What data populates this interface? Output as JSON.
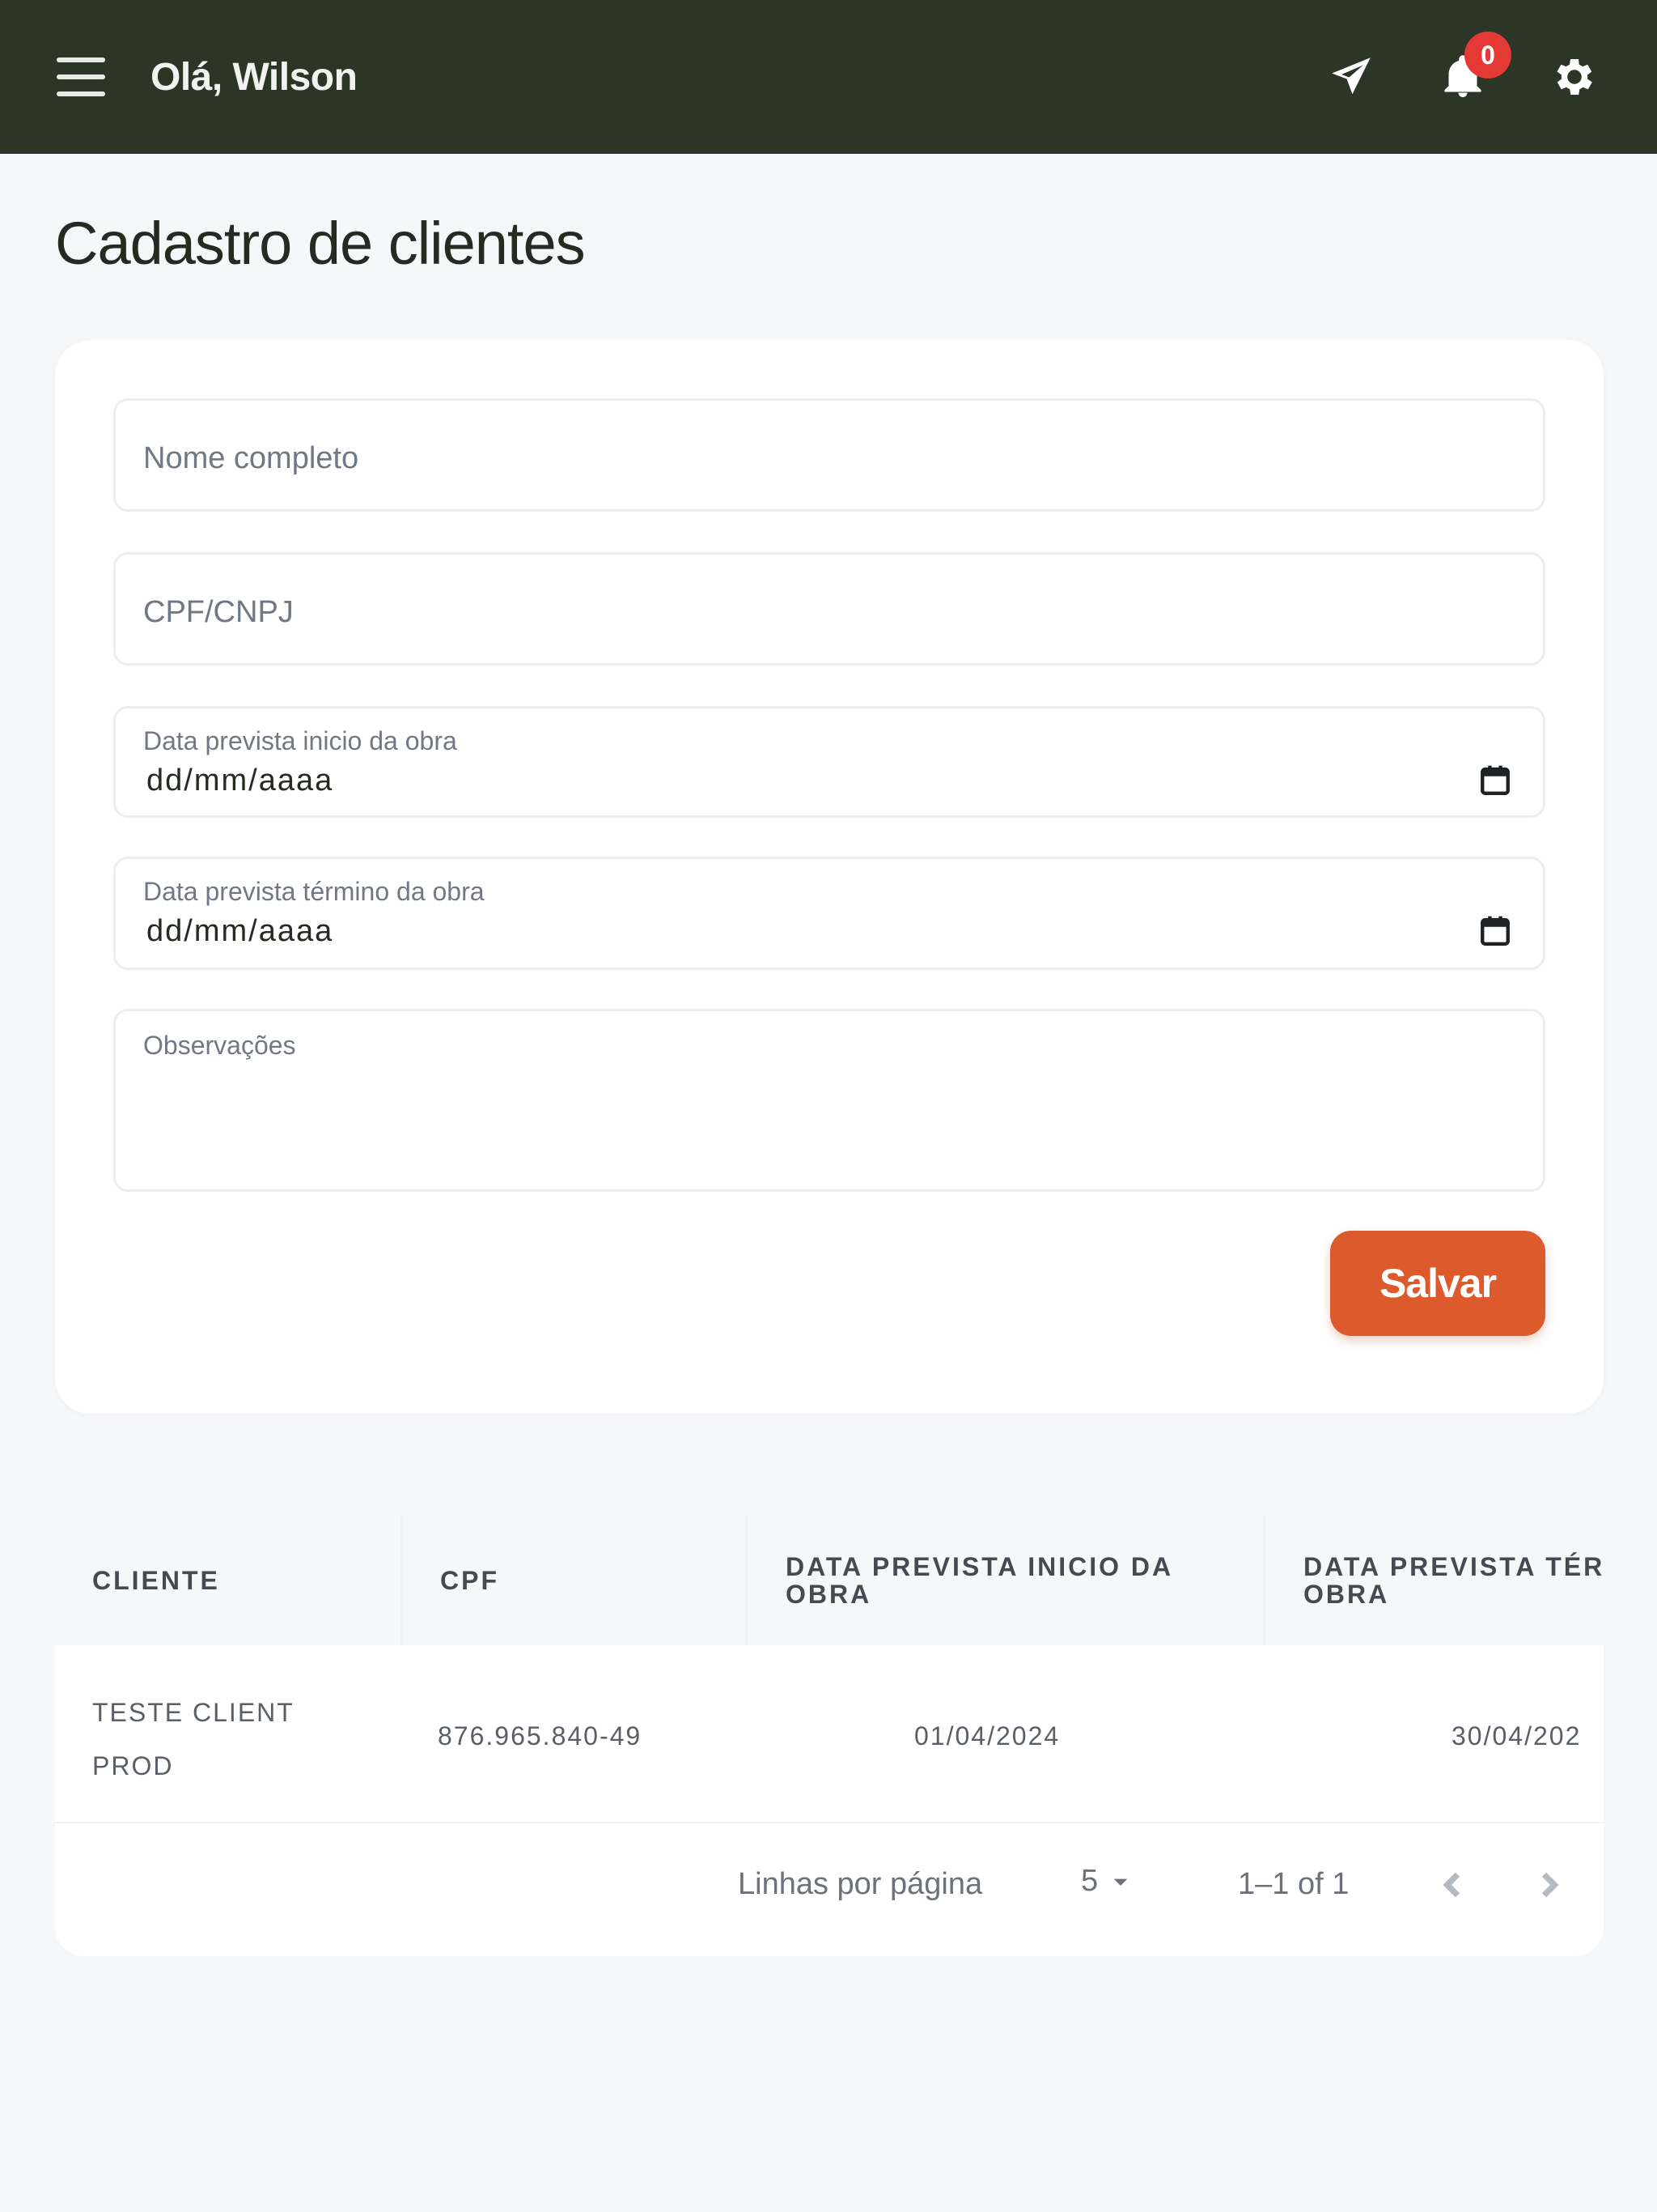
{
  "header": {
    "greeting": "Olá, Wilson",
    "notification_count": "0",
    "icons": [
      "menu-icon",
      "send-icon",
      "bell-icon",
      "gear-icon"
    ],
    "background_color": "#2b3626",
    "badge_color": "#e53935"
  },
  "page": {
    "title": "Cadastro de clientes"
  },
  "form": {
    "name_placeholder": "Nome completo",
    "name_value": "",
    "document_placeholder": "CPF/CNPJ",
    "document_value": "",
    "start_date_label": "Data prevista inicio da obra",
    "start_date_value": "dd/mm/aaaa",
    "end_date_label": "Data prevista término da obra",
    "end_date_value": "dd/mm/aaaa",
    "notes_label": "Observações",
    "notes_value": "",
    "save_label": "Salvar",
    "save_color": "#dc5a2c"
  },
  "table": {
    "columns": [
      "CLIENTE",
      "CPF",
      "DATA PREVISTA INICIO DA OBRA",
      "DATA PREVISTA TÉR OBRA"
    ],
    "rows": [
      {
        "cliente": "TESTE CLIENT PROD",
        "cpf": "876.965.840-49",
        "inicio": "01/04/2024",
        "termino": "30/04/202"
      }
    ],
    "pagination": {
      "rows_per_page_label": "Linhas por página",
      "rows_per_page_value": "5",
      "range_text": "1–1 of 1"
    }
  }
}
